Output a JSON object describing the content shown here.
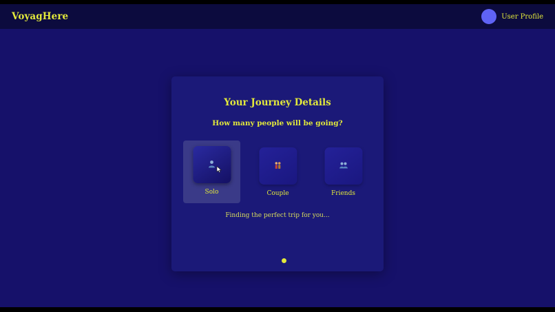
{
  "navbar": {
    "brand": "VoyagHere",
    "profile_label": "User Profile"
  },
  "card": {
    "title": "Your Journey Details",
    "question": "How many people will be going?",
    "options": [
      {
        "label": "Solo",
        "icon": "person-icon",
        "selected": true
      },
      {
        "label": "Couple",
        "icon": "couple-icon",
        "selected": false
      },
      {
        "label": "Friends",
        "icon": "friends-icon",
        "selected": false
      }
    ],
    "status": "Finding the perfect trip for you..."
  },
  "colors": {
    "background": "#16116a",
    "navbar": "#0c0b3e",
    "card": "#1b1978",
    "accent": "#e2e83b",
    "avatar": "#5f63f5"
  }
}
